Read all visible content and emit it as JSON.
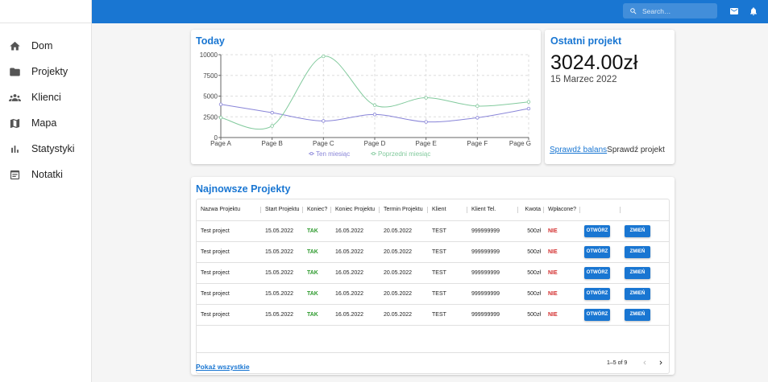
{
  "sidebar": {
    "items": [
      {
        "label": "Dom",
        "icon": "home-icon"
      },
      {
        "label": "Projekty",
        "icon": "folder-icon"
      },
      {
        "label": "Klienci",
        "icon": "people-icon"
      },
      {
        "label": "Mapa",
        "icon": "map-icon"
      },
      {
        "label": "Statystyki",
        "icon": "bar-chart-icon"
      },
      {
        "label": "Notatki",
        "icon": "notes-icon"
      }
    ]
  },
  "topbar": {
    "search_placeholder": "Search…",
    "color": "#1976d2",
    "icons": [
      "search-icon",
      "mail-icon",
      "bell-icon"
    ]
  },
  "today": {
    "title": "Today"
  },
  "chart_data": {
    "type": "line",
    "title": "Today",
    "categories": [
      "Page A",
      "Page B",
      "Page C",
      "Page D",
      "Page E",
      "Page F",
      "Page G"
    ],
    "series": [
      {
        "name": "Ten miesiąc",
        "color": "#8884d8",
        "values": [
          4000,
          3000,
          2000,
          2780,
          1890,
          2390,
          3490
        ]
      },
      {
        "name": "Poprzedni miesiąc",
        "color": "#82ca9d",
        "values": [
          2400,
          1398,
          9800,
          3908,
          4800,
          3800,
          4300
        ]
      }
    ],
    "ylim": [
      0,
      10000
    ],
    "yticks": [
      0,
      2500,
      5000,
      7500,
      10000
    ],
    "grid": true,
    "legend": "bottom"
  },
  "recent": {
    "title": "Ostatni projekt",
    "amount": "3024.00zł",
    "date": "15 Marzec 2022",
    "link_balance": "Sprawdź balans",
    "link_project": "Sprawdź projekt"
  },
  "projects": {
    "title": "Najnowsze Projekty",
    "columns": [
      "Nazwa Projektu",
      "Start Projektu",
      "Koniec?",
      "Koniec Projektu",
      "Termin Projektu",
      "Klient",
      "Klient Tel.",
      "Kwota",
      "Wpłacone?",
      "",
      ""
    ],
    "open_label": "OTWÓRZ",
    "edit_label": "ZMIEŃ",
    "rows": [
      {
        "name": "Test project",
        "start": "15.05.2022",
        "done": "TAK",
        "end": "16.05.2022",
        "deadline": "20.05.2022",
        "client": "TEST",
        "phone": "999999999",
        "amount": "500zł",
        "paid": "NIE"
      },
      {
        "name": "Test project",
        "start": "15.05.2022",
        "done": "TAK",
        "end": "16.05.2022",
        "deadline": "20.05.2022",
        "client": "TEST",
        "phone": "999999999",
        "amount": "500zł",
        "paid": "NIE"
      },
      {
        "name": "Test project",
        "start": "15.05.2022",
        "done": "TAK",
        "end": "16.05.2022",
        "deadline": "20.05.2022",
        "client": "TEST",
        "phone": "999999999",
        "amount": "500zł",
        "paid": "NIE"
      },
      {
        "name": "Test project",
        "start": "15.05.2022",
        "done": "TAK",
        "end": "16.05.2022",
        "deadline": "20.05.2022",
        "client": "TEST",
        "phone": "999999999",
        "amount": "500zł",
        "paid": "NIE"
      },
      {
        "name": "Test project",
        "start": "15.05.2022",
        "done": "TAK",
        "end": "16.05.2022",
        "deadline": "20.05.2022",
        "client": "TEST",
        "phone": "999999999",
        "amount": "500zł",
        "paid": "NIE"
      }
    ],
    "pager": "1–5 of 9",
    "show_all": "Pokaż wszystkie"
  }
}
